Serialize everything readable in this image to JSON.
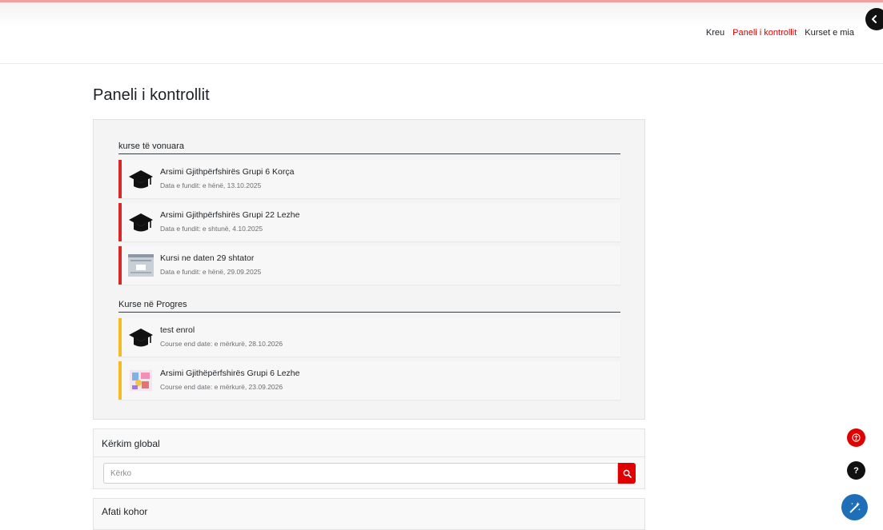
{
  "nav": {
    "links": [
      "Kreu",
      "Paneli i kontrollit",
      "Kurset e mia"
    ],
    "active": "Paneli i kontrollit"
  },
  "page": {
    "title": "Paneli i kontrollit"
  },
  "overdue": {
    "heading": "kurse të vonuara",
    "courses": [
      {
        "name": "Arsimi Gjithpërfshirës Grupi 6 Korça",
        "date": "Data e fundit: e hënë, 13.10.2025",
        "thumb": "graduation-cap-icon"
      },
      {
        "name": "Arsimi Gjithpërfshirës Grupi 22 Lezhe",
        "date": "Data e fundit: e shtunë, 4.10.2025",
        "thumb": "graduation-cap-icon"
      },
      {
        "name": "Kursi ne daten 29 shtator",
        "date": "Data e fundit: e hënë, 29.09.2025",
        "thumb": "screenshot-thumbnail"
      }
    ]
  },
  "inprogress": {
    "heading": "Kurse në Progres",
    "courses": [
      {
        "name": "test enrol",
        "date": "Course end date: e mërkurë, 28.10.2026",
        "thumb": "graduation-cap-icon"
      },
      {
        "name": "Arsimi Gjithëpërfshirës Grupi 6 Lezhe",
        "date": "Course end date: e mërkurë, 23.09.2026",
        "thumb": "illustration-thumbnail"
      }
    ]
  },
  "search": {
    "title": "Kërkim global",
    "placeholder": "Kërko"
  },
  "timeline": {
    "title": "Afati kohor"
  },
  "floating": {
    "help": "?"
  },
  "colors": {
    "accent": "#e00000",
    "overdue": "#d82828",
    "progress": "#f5bb22",
    "magic": "#1f6fb8"
  }
}
